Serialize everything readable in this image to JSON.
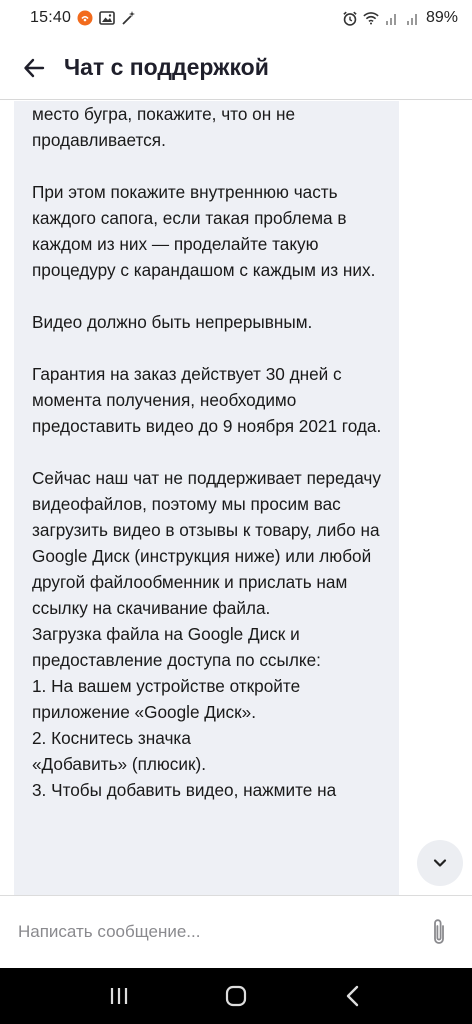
{
  "status_bar": {
    "time": "15:40",
    "battery": "89%",
    "icons": [
      "app-notification-icon",
      "image-icon",
      "magic-wand-icon",
      "alarm-icon",
      "wifi-icon",
      "signal-icon",
      "signal-icon",
      "battery-icon"
    ]
  },
  "header": {
    "title": "Чат с поддержкой",
    "back_icon": "arrow-left-icon"
  },
  "message": {
    "text": "место бугра, покажите, что он не продавливается.\n\nПри этом покажите внутреннюю часть каждого сапога, если такая проблема в каждом из них — проделайте такую процедуру с карандашом с каждым из них.\n\nВидео должно быть непрерывным.\n\nГарантия на заказ действует 30 дней с момента получения, необходимо предоставить видео до 9 ноября 2021 года.\n\nСейчас наш чат не поддерживает передачу видеофайлов, поэтому мы просим вас загрузить видео в отзывы к товару, либо на Google Диск (инструкция ниже) или любой другой файлообменник и прислать нам ссылку на скачивание файла.\nЗагрузка файла на Google Диск и предоставление доступа по ссылке:\n1. На вашем устройстве откройте приложение «Google Диск».\n2. Коснитесь значка\n«Добавить» (плюсик).\n3. Чтобы добавить видео, нажмите на"
  },
  "input": {
    "placeholder": "Написать сообщение..."
  },
  "colors": {
    "bubble_bg": "#eef0f5",
    "nav_bg": "#000000",
    "notif_orange": "#f26b1d"
  }
}
